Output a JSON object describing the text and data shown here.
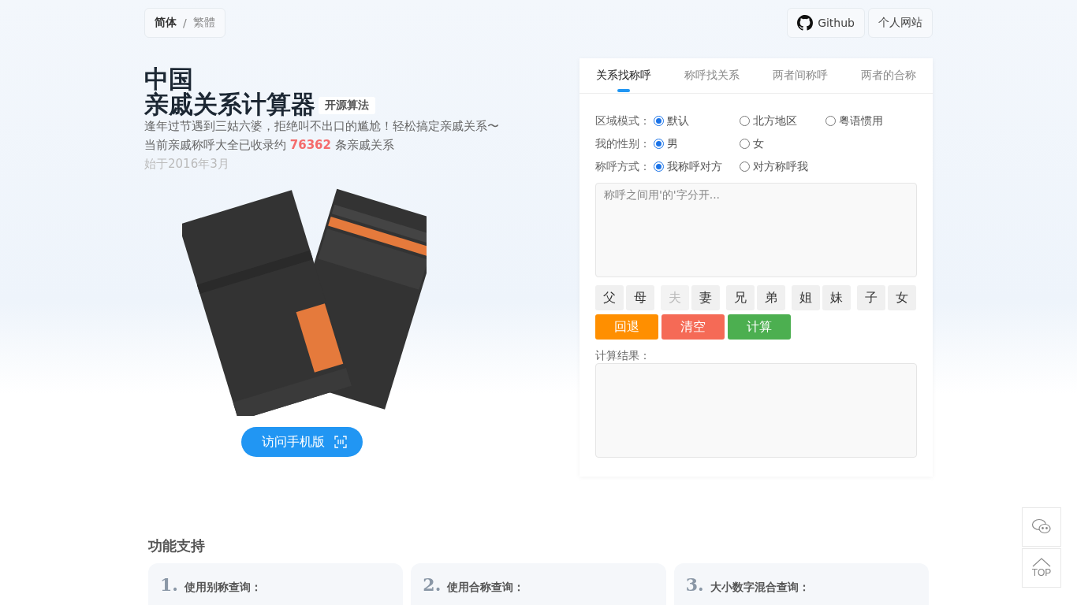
{
  "language_switch": [
    {
      "label": "简体",
      "selected": true
    },
    {
      "label": "繁體",
      "selected": false
    }
  ],
  "separator": "/",
  "top_links": [
    {
      "kind": "github",
      "label": "Github"
    },
    {
      "kind": "plain",
      "label": "个人网站"
    }
  ],
  "hero": {
    "title_line1": "中国",
    "title_line2": "亲戚关系计算器",
    "badge": "开源算法",
    "slogan": "逢年过节遇到三姑六婆，拒绝叫不出口的尴尬！轻松搞定亲戚关系〜",
    "count_text": "当前亲戚称呼大全已收录约 **76362** 条亲戚关系",
    "since": "始于2016年3月",
    "mobile_button": "访问手机版"
  },
  "tabs": [
    {
      "label": "关系找称呼",
      "selected": true
    },
    {
      "label": "称呼找关系",
      "selected": false
    },
    {
      "label": "两者间称呼",
      "selected": false
    },
    {
      "label": "两者的合称",
      "selected": false
    }
  ],
  "options": [
    {
      "label": "区域模式：",
      "choices": [
        {
          "label": "默认",
          "selected": true
        },
        {
          "label": "北方地区",
          "selected": false
        },
        {
          "label": "粤语惯用",
          "selected": false
        }
      ]
    },
    {
      "label": "我的性别：",
      "choices": [
        {
          "label": "男",
          "selected": true
        },
        {
          "label": "女",
          "selected": false
        }
      ]
    },
    {
      "label": "称呼方式：",
      "choices": [
        {
          "label": "我称呼对方",
          "selected": true
        },
        {
          "label": "对方称呼我",
          "selected": false
        }
      ]
    }
  ],
  "input": {
    "placeholder": "称呼之间用'的'字分开..."
  },
  "key_groups": [
    [
      {
        "label": "父",
        "disabled": false
      },
      {
        "label": "母",
        "disabled": false
      }
    ],
    [
      {
        "label": "夫",
        "disabled": true
      },
      {
        "label": "妻",
        "disabled": false
      }
    ],
    [
      {
        "label": "兄",
        "disabled": false
      },
      {
        "label": "弟",
        "disabled": false
      }
    ],
    [
      {
        "label": "姐",
        "disabled": false
      },
      {
        "label": "妹",
        "disabled": false
      }
    ],
    [
      {
        "label": "子",
        "disabled": false
      },
      {
        "label": "女",
        "disabled": false
      }
    ]
  ],
  "actions": [
    {
      "kind": "back",
      "label": "回退"
    },
    {
      "kind": "clear",
      "label": "清空"
    },
    {
      "kind": "calc",
      "label": "计算"
    }
  ],
  "result_label": "计算结果：",
  "features": {
    "title": "功能支持",
    "cards": [
      {
        "number": "1.",
        "title": "使用别称查询："
      },
      {
        "number": "2.",
        "title": "使用合称查询："
      },
      {
        "number": "3.",
        "title": "大小数字混合查询："
      }
    ]
  },
  "float_buttons": [
    {
      "kind": "wechat"
    },
    {
      "kind": "top",
      "label": "TOP"
    }
  ]
}
